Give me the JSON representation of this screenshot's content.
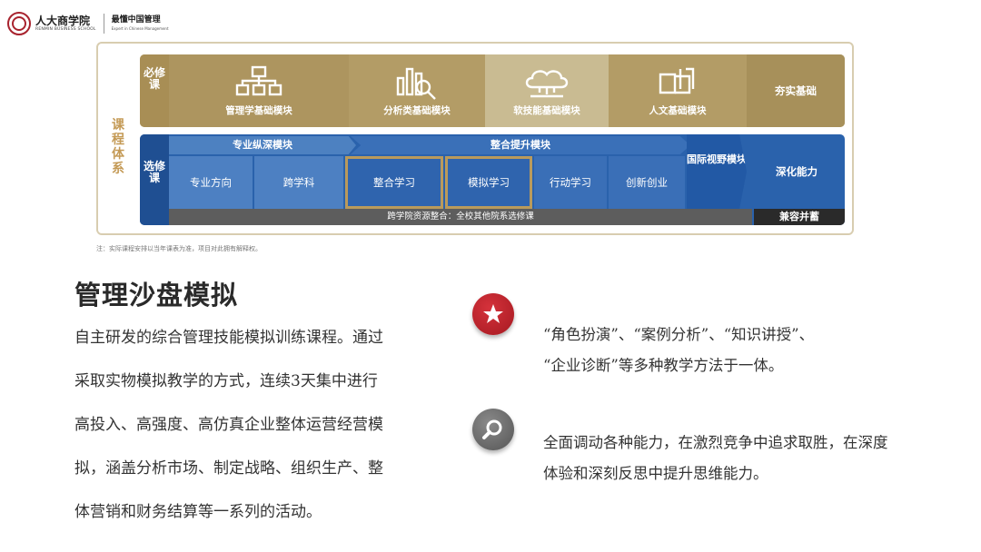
{
  "header": {
    "school_cn": "人大商学院",
    "school_en": "RENMIN BUSINESS SCHOOL",
    "slogan_cn": "最懂中国管理",
    "slogan_en": "Expert in Chinese Management"
  },
  "diagram": {
    "side_label": "课程体系",
    "required": {
      "tag": "必修课",
      "modules": [
        "管理学基础模块",
        "分析类基础模块",
        "软技能基础模块",
        "人文基础模块"
      ],
      "outcome": "夯实基础"
    },
    "elective": {
      "tag": "选修课",
      "arrow1": "专业纵深模块",
      "arrow2": "整合提升模块",
      "cells": [
        "专业方向",
        "跨学科",
        "整合学习",
        "模拟学习",
        "行动学习",
        "创新创业"
      ],
      "intl": "国际视野模块",
      "outcome": "深化能力",
      "resource": "跨学院资源整合：全校其他院系选修课",
      "compat": "兼容并蓄"
    },
    "note": "注：实际课程安排以当年课表为准，项目对此拥有解释权。"
  },
  "content": {
    "title": "管理沙盘模拟",
    "desc_lines": [
      "自主研发的综合管理技能模拟训练课程。通过",
      "采取实物模拟教学的方式，连续3天集中进行",
      "高投入、高强度、高仿真企业整体运营经营模",
      "拟，涵盖分析市场、制定战略、组织生产、整",
      "体营销和财务结算等一系列的活动。"
    ],
    "bullets": [
      {
        "icon": "star-icon",
        "lines": [
          "“角色扮演”、“案例分析”、“知识讲授”、",
          "“企业诊断”等多种教学方法于一体。"
        ]
      },
      {
        "icon": "search-icon",
        "lines": [
          "全面调动各种能力，在激烈竞争中追求取胜，在深度",
          "体验和深刻反思中提升思维能力。"
        ]
      }
    ]
  },
  "colors": {
    "gold": "#b9a46c",
    "blue": "#2a62ac",
    "red": "#a51921"
  }
}
